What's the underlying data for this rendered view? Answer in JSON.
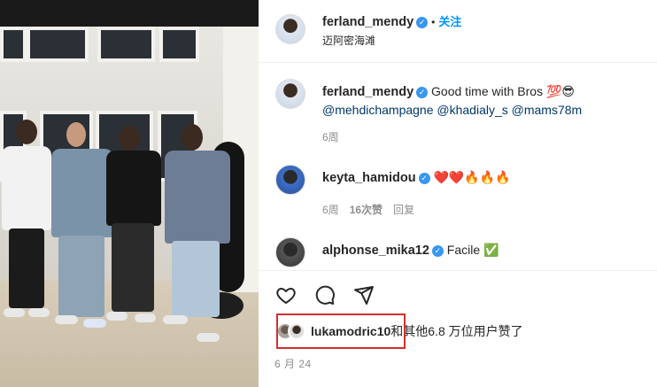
{
  "post": {
    "author": "ferland_mendy",
    "follow_label": "关注",
    "location": "迈阿密海滩",
    "separator": "•"
  },
  "comments": [
    {
      "user": "ferland_mendy",
      "text": "Good time with Bros 💯😎",
      "mentions": "@mehdichampagne @khadialy_s @mams78m",
      "time": "6周"
    },
    {
      "user": "keyta_hamidou",
      "text": "❤️❤️🔥🔥🔥",
      "time": "6周",
      "likes": "16次赞",
      "reply_label": "回复"
    },
    {
      "user": "alphonse_mika12",
      "text": "Facile ✅"
    }
  ],
  "likes": {
    "user": "lukamodric10",
    "suffix": "和其他6.8 万位用户赞了"
  },
  "date": "6 月 24",
  "icons": {
    "like": "heart-icon",
    "comment": "comment-icon",
    "share": "share-icon",
    "verified": "verified-badge-icon"
  },
  "colors": {
    "link": "#00376b",
    "follow": "#0095f6",
    "verified": "#3897f0",
    "highlight_box": "#d32f2f"
  }
}
